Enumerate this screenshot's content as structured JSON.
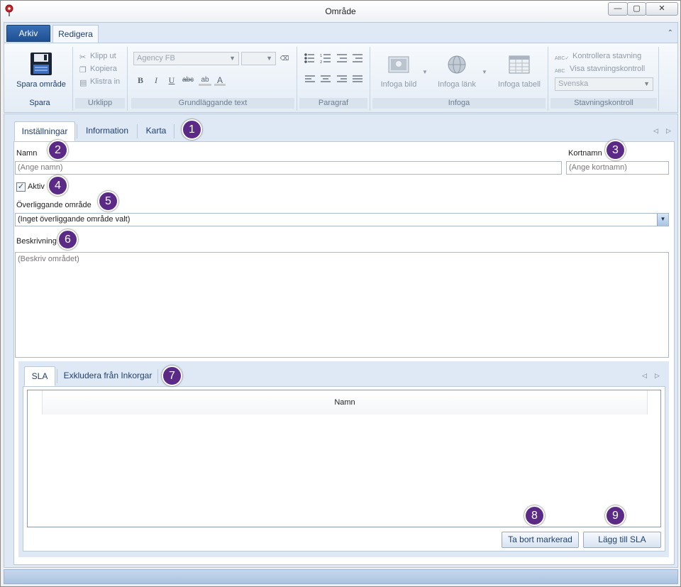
{
  "window": {
    "title": "Område",
    "min_glyph": "—",
    "max_glyph": "▢",
    "close_glyph": "✕"
  },
  "ribbon": {
    "tabs": [
      {
        "label": "Arkiv",
        "active": false
      },
      {
        "label": "Redigera",
        "active": true
      }
    ],
    "collapse_glyph": "⌃",
    "groups": {
      "spara": {
        "label": "Spara",
        "save_button": "Spara område"
      },
      "urklipp": {
        "label": "Urklipp",
        "cut": "Klipp ut",
        "copy": "Kopiera",
        "paste": "Klistra in"
      },
      "grundlaggande_text": {
        "label": "Grundläggande text",
        "font_value": "Agency FB",
        "size_value": "",
        "bold": "B",
        "italic": "I",
        "underline": "U",
        "strike": "abc",
        "highlight": "ab",
        "font_color": "A"
      },
      "paragraf": {
        "label": "Paragraf"
      },
      "infoga": {
        "label": "Infoga",
        "image": "Infoga bild",
        "link": "Infoga länk",
        "table": "Infoga tabell"
      },
      "stavningskontroll": {
        "label": "Stavningskontroll",
        "check": "Kontrollera stavning",
        "show": "Visa stavningskontroll",
        "language": "Svenska"
      }
    }
  },
  "main": {
    "tabs": [
      {
        "label": "Inställningar",
        "active": true
      },
      {
        "label": "Information",
        "active": false
      },
      {
        "label": "Karta",
        "active": false
      }
    ],
    "form": {
      "name_label": "Namn",
      "name_placeholder": "(Ange namn)",
      "shortname_label": "Kortnamn",
      "shortname_placeholder": "(Ange kortnamn)",
      "active_label": "Aktiv",
      "active_checked": true,
      "parent_label": "Överliggande område",
      "parent_value": "(Inget överliggande område valt)",
      "description_label": "Beskrivning",
      "description_placeholder": "(Beskriv området)"
    },
    "sub_tabs": [
      {
        "label": "SLA",
        "active": true
      },
      {
        "label": "Exkludera från Inkorgar",
        "active": false
      }
    ],
    "grid": {
      "columns": [
        "Namn"
      ],
      "rows": []
    },
    "buttons": {
      "remove": "Ta bort markerad",
      "add": "Lägg till SLA"
    }
  },
  "callouts": [
    "1",
    "2",
    "3",
    "4",
    "5",
    "6",
    "7",
    "8",
    "9"
  ],
  "colors": {
    "accent": "#1e4f92",
    "callout": "#5b2a86",
    "panel_bg": "#dfe9f5"
  }
}
